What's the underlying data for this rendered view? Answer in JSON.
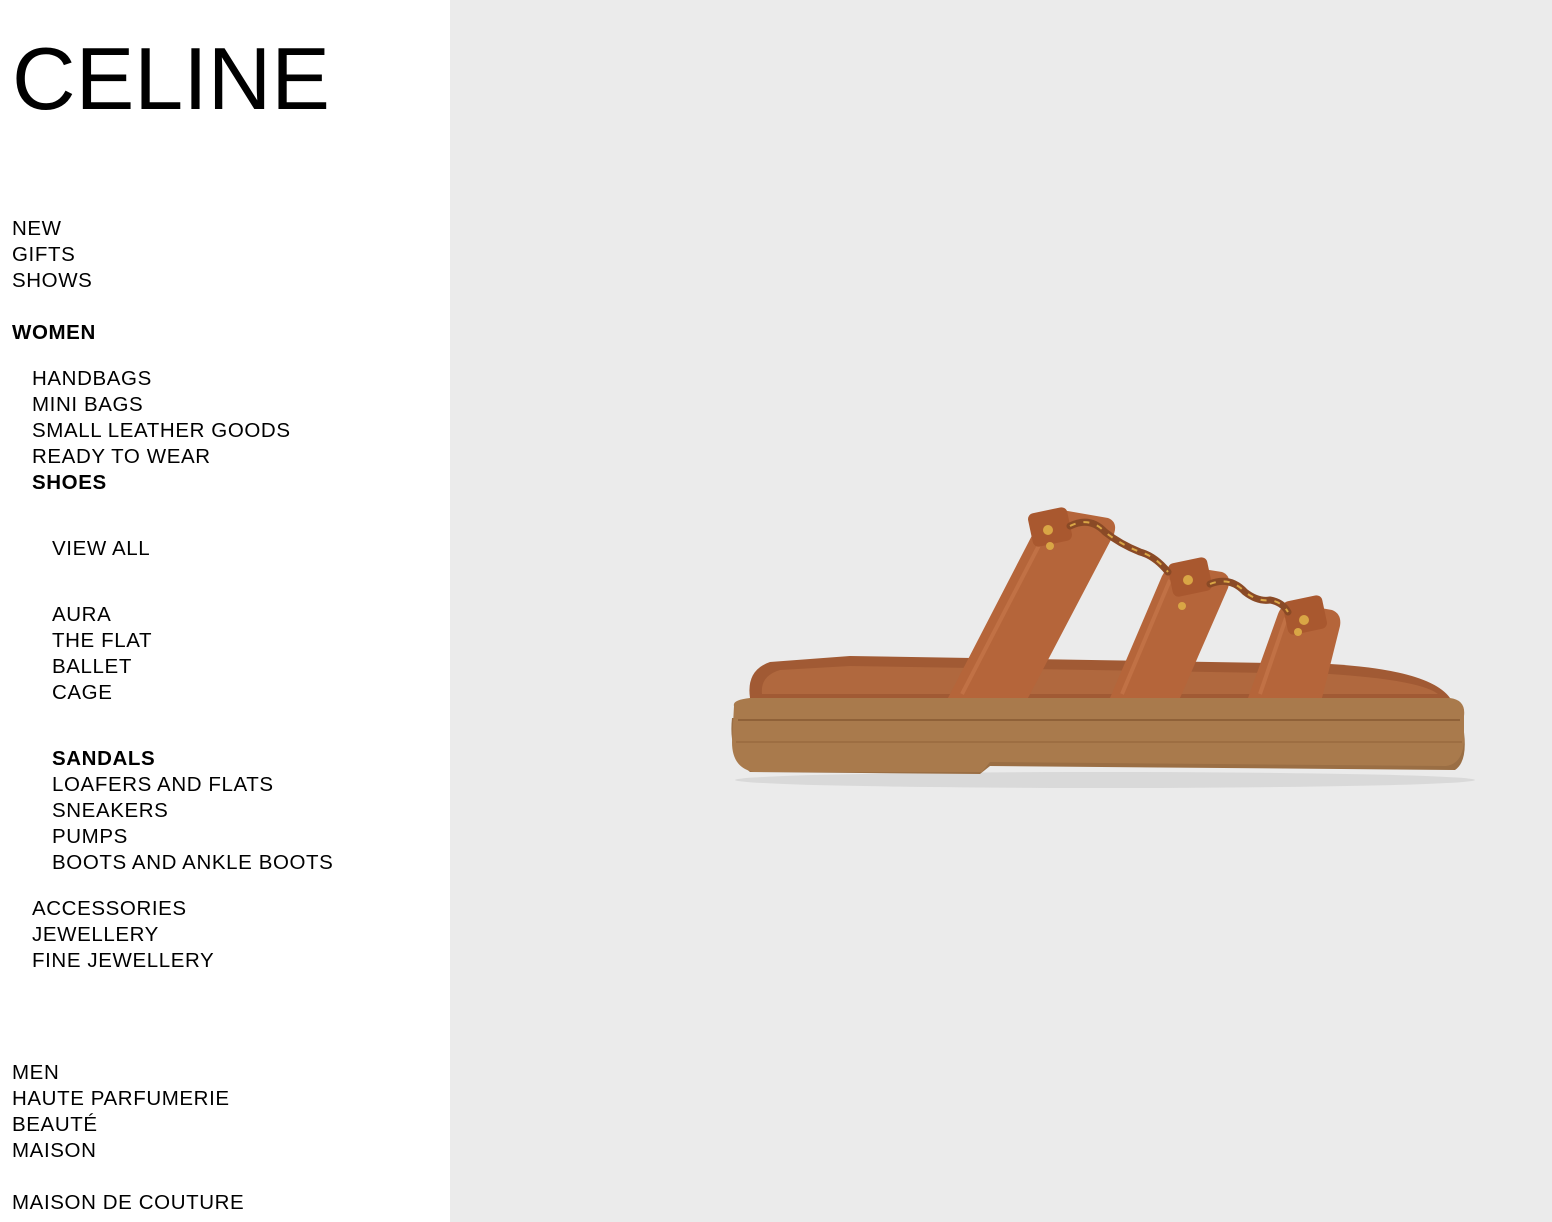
{
  "brand": {
    "logo_text": "CELINE"
  },
  "nav": {
    "top": [
      "NEW",
      "GIFTS",
      "SHOWS"
    ],
    "women": {
      "label": "WOMEN",
      "categories_before": [
        "HANDBAGS",
        "MINI BAGS",
        "SMALL LEATHER GOODS",
        "READY TO WEAR"
      ],
      "shoes": {
        "label": "SHOES",
        "view_all": "VIEW ALL",
        "collections": [
          "AURA",
          "THE FLAT",
          "BALLET",
          "CAGE"
        ],
        "types": [
          "SANDALS",
          "LOAFERS AND FLATS",
          "SNEAKERS",
          "PUMPS",
          "BOOTS AND ANKLE BOOTS"
        ],
        "selected": "SANDALS"
      },
      "categories_after": [
        "ACCESSORIES",
        "JEWELLERY",
        "FINE JEWELLERY"
      ]
    },
    "bottom": [
      "MEN",
      "HAUTE PARFUMERIE",
      "BEAUTÉ",
      "MAISON"
    ],
    "footer_link": "MAISON DE COUTURE"
  },
  "product": {
    "image_icon": "sandal-image",
    "background_color": "#ebebeb",
    "leather_color": "#b5653a",
    "sole_color": "#a97a4c"
  }
}
